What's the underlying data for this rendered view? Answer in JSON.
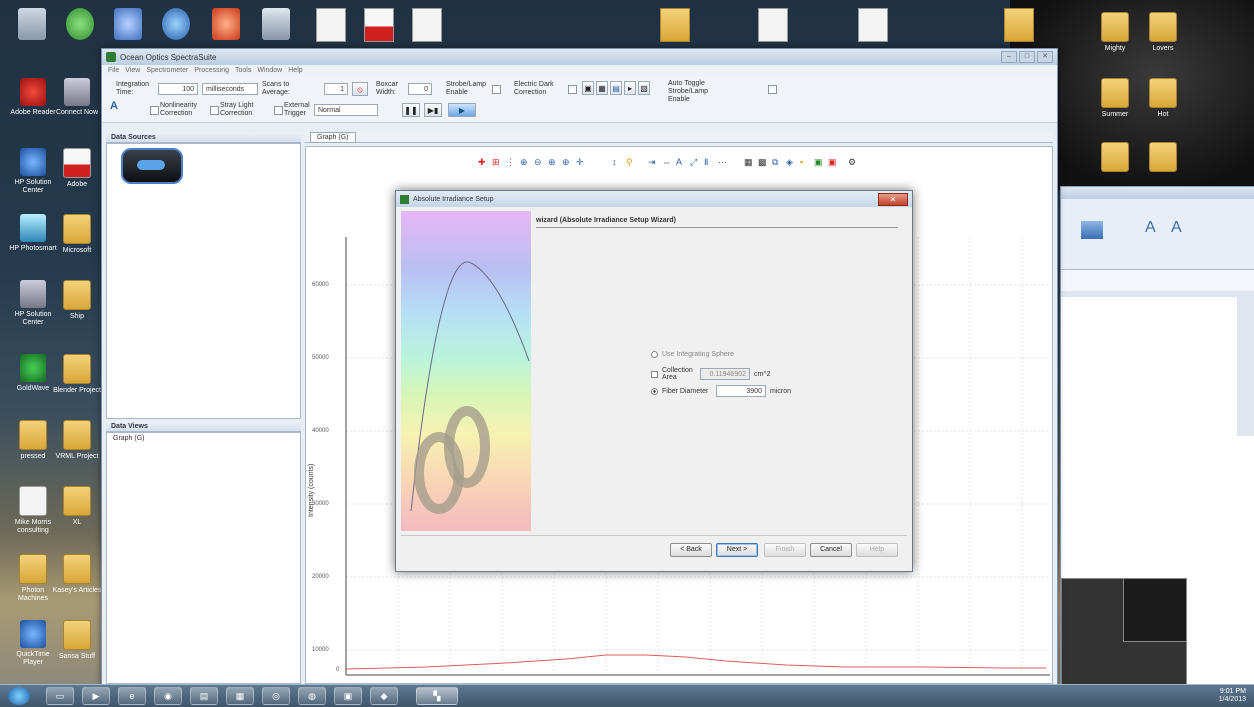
{
  "window": {
    "title": "Ocean Optics SpectraSuite",
    "menu": [
      "File",
      "View",
      "Spectrometer",
      "Processing",
      "Tools",
      "Window",
      "Help"
    ]
  },
  "toolbar": {
    "integration_time_label": "Integration Time:",
    "integration_time_value": "100",
    "integration_unit": "milliseconds",
    "scans_to_average_label": "Scans to Average:",
    "scans_to_average_value": "1",
    "boxcar_width_label": "Boxcar Width:",
    "boxcar_width_value": "0",
    "strobe_lamp_label": "Strobe/Lamp Enable",
    "electric_dark_label": "Electric Dark Correction",
    "auto_toggle_label": "Auto Toggle Strobe/Lamp Enable",
    "nonlinearity_label": "Nonlinearity Correction",
    "stray_light_label": "Stray Light Correction",
    "external_trigger_label": "External Trigger",
    "trigger_mode_value": "Normal"
  },
  "panels": {
    "data_sources_title": "Data Sources",
    "data_views_title": "Data Views",
    "data_views_item": "Graph (G)",
    "graph_tab": "Graph (G)"
  },
  "graph": {
    "y_axis_label": "Intensity (counts)",
    "ticks": [
      "60000",
      "50000",
      "40000",
      "30000",
      "20000",
      "10000",
      "0"
    ]
  },
  "dialog": {
    "title": "Absolute Irradiance Setup",
    "close_label": "✕",
    "wizard_heading": "wizard (Absolute Irradiance Setup Wizard)",
    "options": {
      "integrating_sphere": "Use Integrating Sphere",
      "collection_area_label": "Collection Area",
      "collection_area_value": "0.11946902",
      "collection_area_unit": "cm^2",
      "fiber_diameter_label": "Fiber Diameter",
      "fiber_diameter_value": "3900",
      "fiber_diameter_unit": "micron"
    },
    "buttons": {
      "back": "< Back",
      "next": "Next >",
      "finish": "Finish",
      "cancel": "Cancel",
      "help": "Help"
    }
  },
  "desktop_icons": [
    {
      "label": "Recycle Bin",
      "type": "gray"
    },
    {
      "label": "Adobe Reader",
      "type": "red"
    },
    {
      "label": "HP Solution Center",
      "type": "blue"
    },
    {
      "label": "HP Photosmart",
      "type": "cyan"
    },
    {
      "label": "HP Solution Center",
      "type": "gray"
    },
    {
      "label": "GoldWave",
      "type": "green"
    },
    {
      "label": "pressed",
      "type": "folder"
    },
    {
      "label": "Mike Morris consulting",
      "type": "doc"
    },
    {
      "label": "Photon Machines",
      "type": "folder"
    },
    {
      "label": "QuickTime Player",
      "type": "blue"
    },
    {
      "label": "Connect Now",
      "type": "gray"
    },
    {
      "label": "Microsoft",
      "type": "gray"
    },
    {
      "label": "Adobe",
      "type": "pdf"
    },
    {
      "label": "Ship",
      "type": "folder"
    },
    {
      "label": "Blender Project",
      "type": "folder"
    },
    {
      "label": "VRML Project",
      "type": "folder"
    },
    {
      "label": "XL",
      "type": "folder"
    },
    {
      "label": "Kasey's Articles",
      "type": "folder"
    },
    {
      "label": "Sansa Stuff",
      "type": "folder"
    }
  ],
  "right_icons": [
    "Mighty",
    "Lovers",
    "Summer",
    "Hot"
  ],
  "taskbar": {
    "clock_time": "9:01 PM",
    "clock_date": "1/4/2013"
  }
}
